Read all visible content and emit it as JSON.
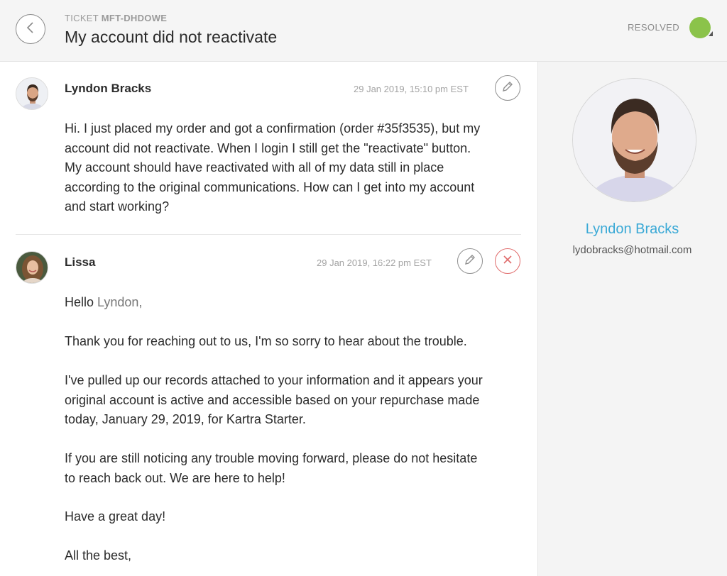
{
  "header": {
    "ticket_prefix": "TICKET",
    "ticket_id": "MFT-DHDOWE",
    "title": "My account did not reactivate",
    "status": "RESOLVED",
    "status_color": "#8bc34a"
  },
  "messages": [
    {
      "author": "Lyndon Bracks",
      "timestamp": "29 Jan 2019, 15:10 pm EST",
      "lines": [
        "Hi.  I just placed my order and got a confirmation (order #35f3535), but my",
        "account did not reactivate.  When I login I still get the \"reactivate\" button.",
        "My account should have reactivated with all of my data still in place",
        "according to the original communications.  How can I get into my account",
        "and start working?"
      ]
    },
    {
      "author": "Lissa",
      "timestamp": "29 Jan 2019, 16:22 pm EST",
      "greeting": "Hello",
      "greeting_name": "Lyndon,",
      "paragraphs": [
        [
          "Thank you for reaching out to us, I'm so sorry to hear about the trouble."
        ],
        [
          "I've pulled up our records attached to your information and it appears your",
          "original account is active and accessible based on your repurchase made",
          "today, January 29, 2019, for Kartra Starter."
        ],
        [
          "If you are still noticing any trouble moving forward, please do not hesitate",
          "to reach back out. We are here to help!"
        ],
        [
          "Have a great day!"
        ],
        [
          "All the best,"
        ]
      ]
    }
  ],
  "profile": {
    "name": "Lyndon Bracks",
    "email": "lydobracks@hotmail.com",
    "name_color": "#3aa9d6"
  }
}
